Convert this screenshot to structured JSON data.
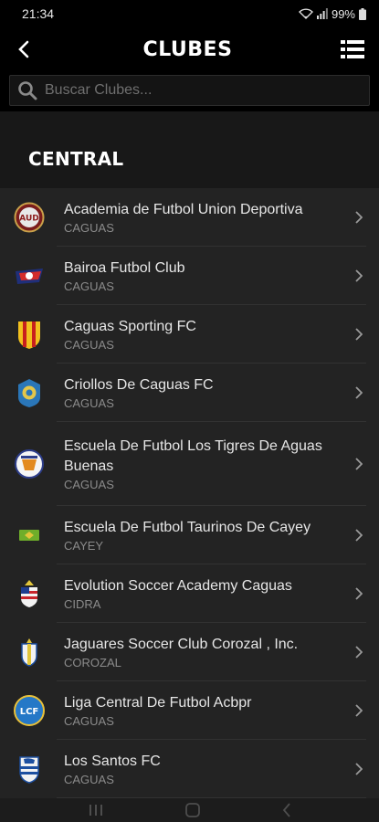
{
  "status": {
    "time": "21:34",
    "battery": "99%"
  },
  "header": {
    "title": "CLUBES"
  },
  "search": {
    "placeholder": "Buscar Clubes..."
  },
  "section": {
    "title": "CENTRAL"
  },
  "clubs": [
    {
      "name": "Academia de Futbol Union Deportiva",
      "city": "CAGUAS"
    },
    {
      "name": "Bairoa Futbol Club",
      "city": "CAGUAS"
    },
    {
      "name": "Caguas Sporting FC",
      "city": "CAGUAS"
    },
    {
      "name": "Criollos De Caguas FC",
      "city": "CAGUAS"
    },
    {
      "name": "Escuela De Futbol Los Tigres De Aguas Buenas",
      "city": "CAGUAS"
    },
    {
      "name": "Escuela De Futbol Taurinos De Cayey",
      "city": "CAYEY"
    },
    {
      "name": "Evolution Soccer Academy Caguas",
      "city": "CIDRA"
    },
    {
      "name": "Jaguares Soccer Club Corozal , Inc.",
      "city": "COROZAL"
    },
    {
      "name": "Liga Central De Futbol Acbpr",
      "city": "CAGUAS"
    },
    {
      "name": "Los Santos FC",
      "city": "CAGUAS"
    }
  ],
  "logo_labels": {
    "club0": "AUD",
    "club8": "LCF"
  },
  "colors": {
    "background": "#232323",
    "app_bar": "#000000",
    "text": "#e6e6e6",
    "subtext": "#8b8b8b"
  }
}
